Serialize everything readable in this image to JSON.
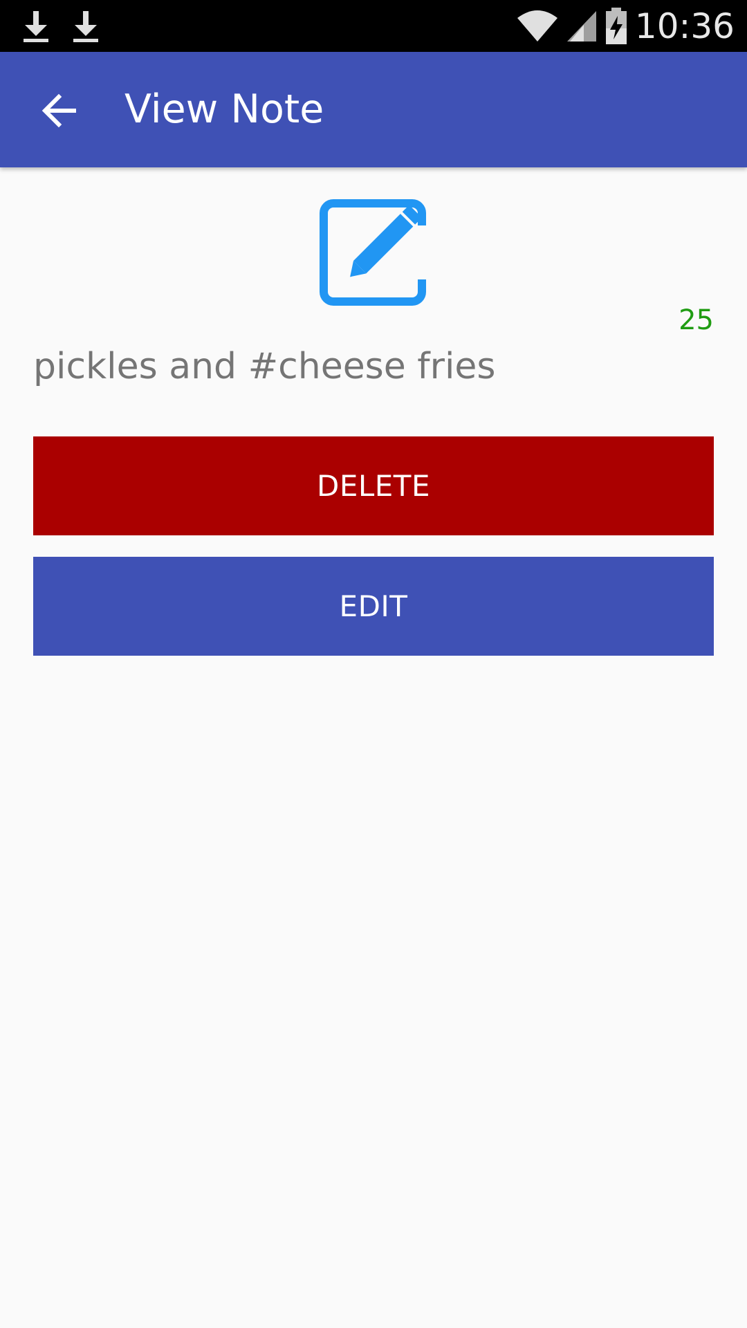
{
  "status_bar": {
    "time": "10:36",
    "left_icons": [
      "download-icon",
      "download-icon"
    ],
    "right_icons": [
      "wifi-icon",
      "signal-icon",
      "battery-charging-icon"
    ]
  },
  "app_bar": {
    "title": "View Note",
    "back_icon": "arrow-back-icon"
  },
  "note": {
    "icon": "edit-note-icon",
    "char_count": "25",
    "text": "pickles and #cheese fries"
  },
  "actions": {
    "delete_label": "DELETE",
    "edit_label": "EDIT"
  },
  "colors": {
    "primary": "#3f51b5",
    "delete": "#aa0000",
    "counter": "#1f9c12",
    "icon": "#2196f3"
  }
}
